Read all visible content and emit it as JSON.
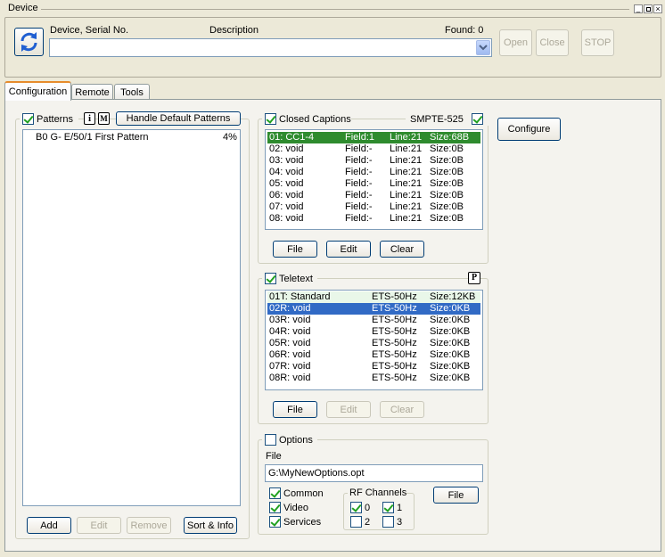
{
  "window": {
    "title": "Device"
  },
  "device": {
    "col_device": "Device, Serial No.",
    "col_description": "Description",
    "found": "Found: 0",
    "open_label": "Open",
    "close_label": "Close",
    "stop_label": "STOP"
  },
  "tabs": [
    {
      "label": "Configuration"
    },
    {
      "label": "Remote"
    },
    {
      "label": "Tools"
    }
  ],
  "patterns": {
    "title": "Patterns",
    "info_label": "i",
    "m_label": "M",
    "handle_default": "Handle Default Patterns",
    "items": [
      {
        "name": "B0 G- E/50/1 First Pattern",
        "pct": "4%"
      }
    ],
    "add": "Add",
    "edit": "Edit",
    "remove": "Remove",
    "sort_info": "Sort & Info"
  },
  "closed_captions": {
    "title": "Closed Captions",
    "standard": "SMPTE-525",
    "configure": "Configure",
    "rows": [
      {
        "id": "01: CC1-4",
        "field": "Field:1",
        "line": "Line:21",
        "size": "Size:68B"
      },
      {
        "id": "02: void",
        "field": "Field:-",
        "line": "Line:21",
        "size": "Size:0B"
      },
      {
        "id": "03: void",
        "field": "Field:-",
        "line": "Line:21",
        "size": "Size:0B"
      },
      {
        "id": "04: void",
        "field": "Field:-",
        "line": "Line:21",
        "size": "Size:0B"
      },
      {
        "id": "05: void",
        "field": "Field:-",
        "line": "Line:21",
        "size": "Size:0B"
      },
      {
        "id": "06: void",
        "field": "Field:-",
        "line": "Line:21",
        "size": "Size:0B"
      },
      {
        "id": "07: void",
        "field": "Field:-",
        "line": "Line:21",
        "size": "Size:0B"
      },
      {
        "id": "08: void",
        "field": "Field:-",
        "line": "Line:21",
        "size": "Size:0B"
      }
    ],
    "file": "File",
    "edit": "Edit",
    "clear": "Clear"
  },
  "teletext": {
    "title": "Teletext",
    "p_label": "P",
    "rows": [
      {
        "id": "01T: Standard",
        "std": "ETS-50Hz",
        "size": "Size:12KB"
      },
      {
        "id": "02R: void",
        "std": "ETS-50Hz",
        "size": "Size:0KB"
      },
      {
        "id": "03R: void",
        "std": "ETS-50Hz",
        "size": "Size:0KB"
      },
      {
        "id": "04R: void",
        "std": "ETS-50Hz",
        "size": "Size:0KB"
      },
      {
        "id": "05R: void",
        "std": "ETS-50Hz",
        "size": "Size:0KB"
      },
      {
        "id": "06R: void",
        "std": "ETS-50Hz",
        "size": "Size:0KB"
      },
      {
        "id": "07R: void",
        "std": "ETS-50Hz",
        "size": "Size:0KB"
      },
      {
        "id": "08R: void",
        "std": "ETS-50Hz",
        "size": "Size:0KB"
      }
    ],
    "file": "File",
    "edit": "Edit",
    "clear": "Clear"
  },
  "options": {
    "title": "Options",
    "file_label": "File",
    "file_value": "G:\\MyNewOptions.opt",
    "common": "Common",
    "video": "Video",
    "services": "Services",
    "rf_title": "RF Channels",
    "rf": [
      "0",
      "1",
      "2",
      "3"
    ],
    "file_button": "File"
  },
  "colors": {
    "cc_selected": "#2e8b2e",
    "tt_selected": "#316ac5",
    "tt_first": "#e9f7e9"
  }
}
